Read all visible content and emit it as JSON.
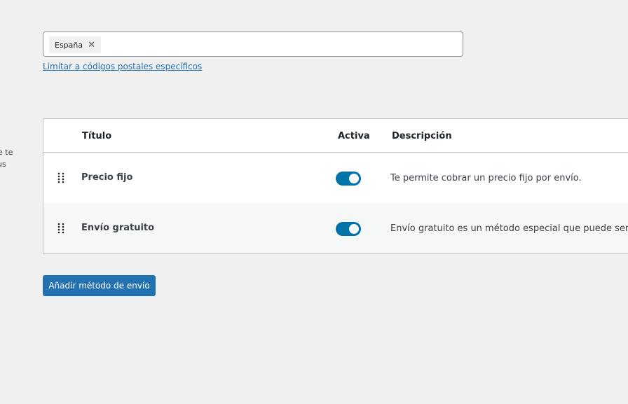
{
  "side_text": {
    "line1": "e te",
    "line2": "us"
  },
  "region": {
    "selected": [
      {
        "label": "España",
        "remove_icon": "close-icon"
      }
    ]
  },
  "limit_link": "Limitar a códigos postales específicos",
  "table": {
    "headers": {
      "title": "Título",
      "active": "Activa",
      "description": "Descripción"
    },
    "rows": [
      {
        "title": "Precio fijo",
        "active": true,
        "description": "Te permite cobrar un precio fijo por envío."
      },
      {
        "title": "Envío gratuito",
        "active": true,
        "description": "Envío gratuito es un método especial que puede ser pr"
      }
    ]
  },
  "add_method_button": "Añadir método de envío",
  "colors": {
    "accent": "#2271b1",
    "toggle_on": "#0073aa",
    "background": "#f0f0f1"
  }
}
